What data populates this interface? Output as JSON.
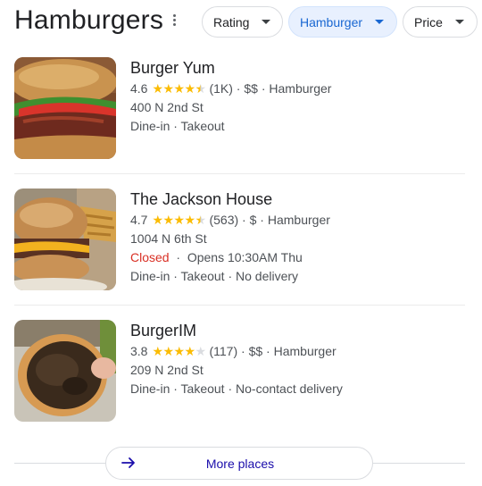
{
  "header": {
    "title": "Hamburgers",
    "filters": [
      {
        "label": "Rating"
      },
      {
        "label": "Hamburger"
      },
      {
        "label": "Price"
      }
    ]
  },
  "places": [
    {
      "name": "Burger Yum",
      "rating": "4.6",
      "stars": 4.5,
      "reviews": "(1K)",
      "price": "$$",
      "category": "Hamburger",
      "address": "400 N 2nd St",
      "services": "Dine-in · Takeout"
    },
    {
      "name": "The Jackson House",
      "rating": "4.7",
      "stars": 4.5,
      "reviews": "(563)",
      "price": "$",
      "category": "Hamburger",
      "address": "1004 N 6th St",
      "status": "Closed",
      "hours": "Opens 10:30AM Thu",
      "services": "Dine-in · Takeout · No delivery"
    },
    {
      "name": "BurgerIM",
      "rating": "3.8",
      "stars": 4,
      "reviews": "(117)",
      "price": "$$",
      "category": "Hamburger",
      "address": "209 N 2nd St",
      "services": "Dine-in · Takeout · No-contact delivery"
    }
  ],
  "more": {
    "label": "More places"
  },
  "colors": {
    "star": "#fbbc04",
    "closed": "#d93025",
    "link": "#1a0dab",
    "chip_active_bg": "#e8f0fe"
  },
  "icons": {
    "menu": "more-vert-icon",
    "arrow": "arrow-right-icon",
    "caret": "caret-down-icon"
  }
}
